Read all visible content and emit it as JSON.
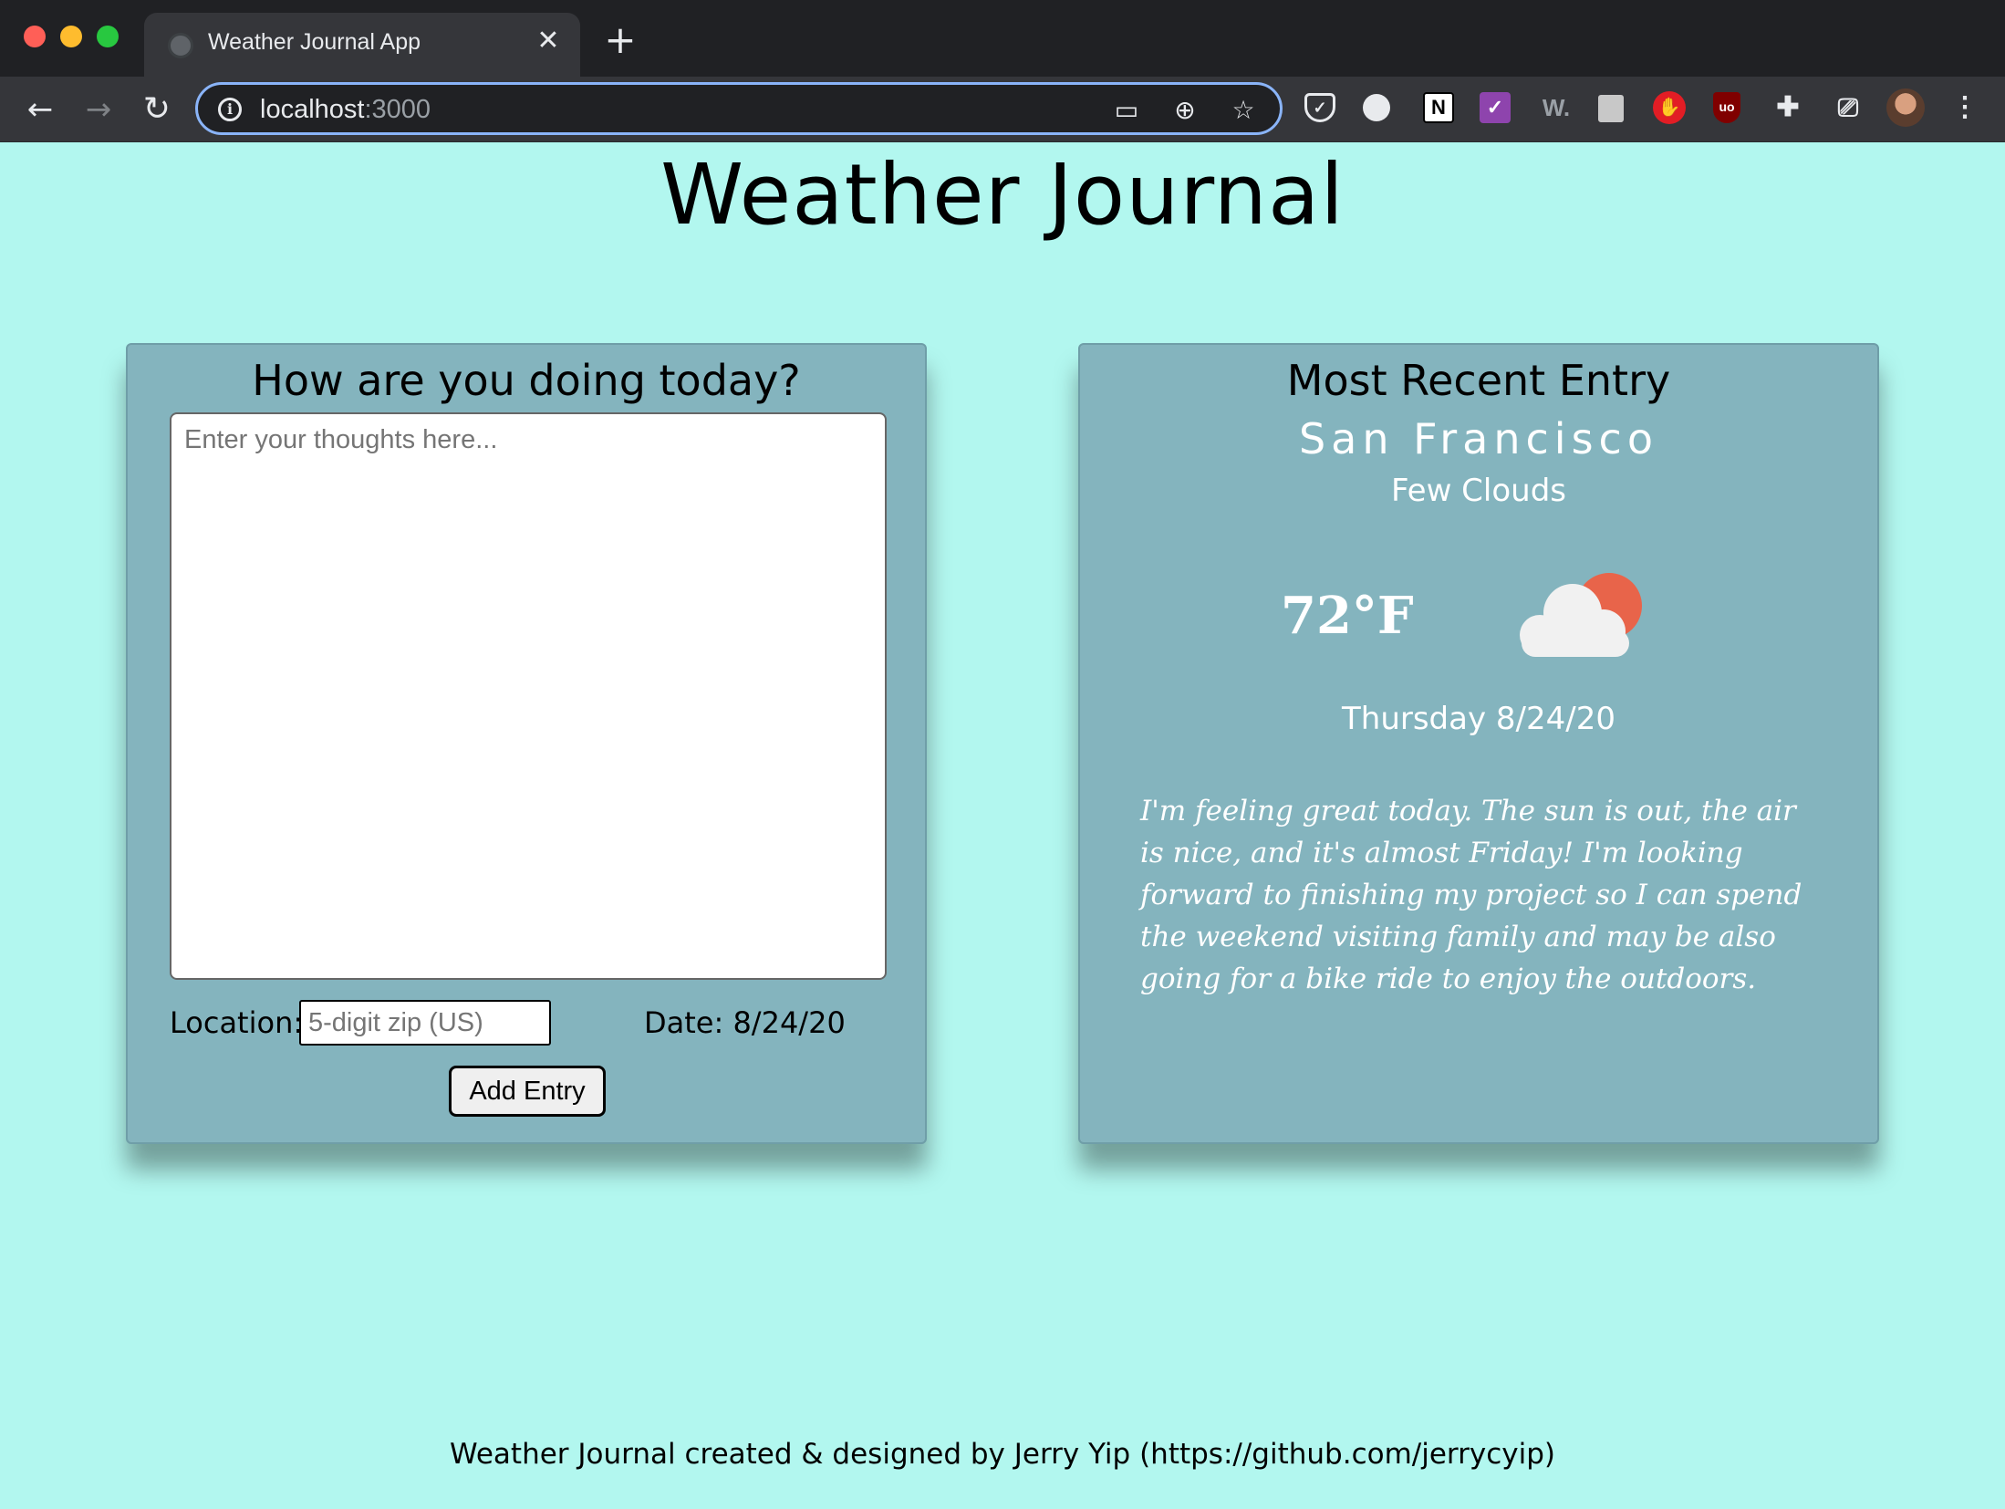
{
  "browser": {
    "tab_title": "Weather Journal App",
    "tab_close": "✕",
    "new_tab": "+",
    "url_host": "localhost",
    "url_port": ":3000",
    "back": "←",
    "forward": "→",
    "reload": "↻",
    "info": "i",
    "cast_icon": "▭",
    "zoom_icon": "⊕",
    "star_icon": "☆",
    "extensions": {
      "pocket": "✓",
      "notion": "N",
      "purple": "✓",
      "w": "W.",
      "hand": "✋",
      "ublock": "uo",
      "puzzle": "✚",
      "cast": "⎚",
      "menu": "⋮"
    }
  },
  "page": {
    "title": "Weather Journal"
  },
  "form": {
    "heading": "How are you doing today?",
    "feelings_placeholder": "Enter your thoughts here...",
    "location_label": "Location:",
    "zip_placeholder": "5-digit zip (US)",
    "date": "Date: 8/24/20",
    "add_button": "Add Entry"
  },
  "recent": {
    "heading": "Most Recent Entry",
    "city": "San Francisco",
    "condition": "Few Clouds",
    "temperature": "72°F",
    "weather_icon": "few-clouds-icon",
    "date": "Thursday 8/24/20",
    "entry": "I'm feeling great today. The sun is out, the air is nice, and it's almost Friday! I'm looking forward to finishing my project so I can spend the weekend visiting family and may be also going for a bike ride to enjoy the outdoors."
  },
  "footer": {
    "text": "Weather Journal created & designed by Jerry Yip (https://github.com/jerrycyip)"
  },
  "colors": {
    "page_bg": "#b2f7ef",
    "card_bg": "#84b4be",
    "sun": "#e8644a",
    "cloud": "#f1f1f1"
  }
}
